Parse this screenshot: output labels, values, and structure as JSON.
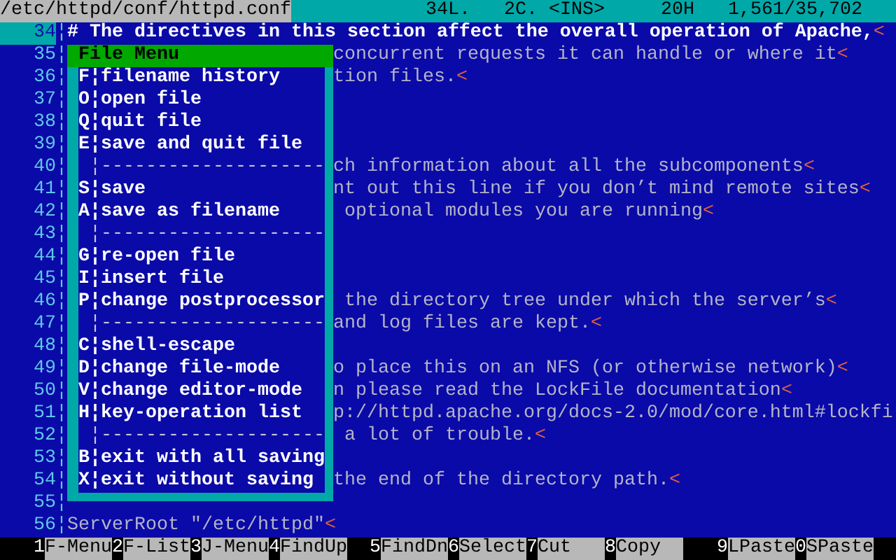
{
  "status_bar": {
    "path": "/etc/httpd/conf/httpd.conf",
    "fields": [
      "34L.",
      "2C.",
      "<INS>",
      "20H",
      "1,561/35,702"
    ]
  },
  "lines": [
    {
      "number": "34",
      "gutter": "¦",
      "text": "# The directives in this section affect the overall operation of Apache,",
      "eol": "<",
      "selected": true
    },
    {
      "number": "35",
      "gutter": "¦",
      "text": "concurrent requests it can handle or where it",
      "eol": "<",
      "selected": false
    },
    {
      "number": "36",
      "gutter": "¦",
      "text": "tion files.",
      "eol": "<",
      "selected": false
    },
    {
      "number": "37",
      "gutter": "¦",
      "selected": false
    },
    {
      "number": "38",
      "gutter": "¦",
      "selected": false
    },
    {
      "number": "39",
      "gutter": "¦",
      "selected": false
    },
    {
      "number": "40",
      "gutter": "¦",
      "text": "ch information about all the subcomponents",
      "eol": "<",
      "selected": false
    },
    {
      "number": "41",
      "gutter": "¦",
      "text": "nt out this line if you don’t mind remote sites",
      "eol": "<",
      "selected": false
    },
    {
      "number": "42",
      "gutter": "¦",
      "text": " optional modules you are running",
      "eol": "<",
      "selected": false
    },
    {
      "number": "43",
      "gutter": "¦",
      "selected": false
    },
    {
      "number": "44",
      "gutter": "¦",
      "selected": false
    },
    {
      "number": "45",
      "gutter": "¦",
      "selected": false
    },
    {
      "number": "46",
      "gutter": "¦",
      "text": " the directory tree under which the server’s",
      "eol": "<",
      "selected": false
    },
    {
      "number": "47",
      "gutter": "¦",
      "text": "and log files are kept.",
      "eol": "<",
      "selected": false
    },
    {
      "number": "48",
      "gutter": "¦",
      "selected": false
    },
    {
      "number": "49",
      "gutter": "¦",
      "text": "o place this on an NFS (or otherwise network)",
      "eol": "<",
      "selected": false
    },
    {
      "number": "50",
      "gutter": "¦",
      "text": "n please read the LockFile documentation",
      "eol": "<",
      "selected": false
    },
    {
      "number": "51",
      "gutter": "¦",
      "text": "p://httpd.apache.org/docs-2.0/mod/core.html#lockfi",
      "selected": false
    },
    {
      "number": "52",
      "gutter": "¦",
      "text": " a lot of trouble.",
      "eol": "<",
      "selected": false
    },
    {
      "number": "53",
      "gutter": "¦",
      "selected": false
    },
    {
      "number": "54",
      "gutter": "¦",
      "text": "the end of the directory path.",
      "eol": "<",
      "selected": false
    },
    {
      "number": "55",
      "gutter": "¦",
      "selected": false
    },
    {
      "number": "56",
      "gutter": "¦",
      "text": "ServerRoot \"/etc/httpd\"",
      "eol": "<",
      "selected": false
    }
  ],
  "file_menu": {
    "title": "File Menu",
    "items": [
      {
        "kind": "item",
        "text": "F¦filename history"
      },
      {
        "kind": "item",
        "text": "O¦open file"
      },
      {
        "kind": "item",
        "text": "Q¦quit file"
      },
      {
        "kind": "item",
        "text": "E¦save and quit file"
      },
      {
        "kind": "separator",
        "text": "¦--------------------"
      },
      {
        "kind": "item",
        "text": "S¦save"
      },
      {
        "kind": "item",
        "text": "A¦save as filename"
      },
      {
        "kind": "separator",
        "text": "¦--------------------"
      },
      {
        "kind": "item",
        "text": "G¦re-open file"
      },
      {
        "kind": "item",
        "text": "I¦insert file"
      },
      {
        "kind": "item",
        "text": "P¦change postprocessor"
      },
      {
        "kind": "separator",
        "text": "¦--------------------"
      },
      {
        "kind": "item",
        "text": "C¦shell-escape"
      },
      {
        "kind": "item",
        "text": "D¦change file-mode"
      },
      {
        "kind": "item",
        "text": "V¦change editor-mode"
      },
      {
        "kind": "item",
        "text": "H¦key-operation list"
      },
      {
        "kind": "separator",
        "text": "¦--------------------"
      },
      {
        "kind": "item",
        "text": "B¦exit with all saving"
      },
      {
        "kind": "item",
        "text": "X¦exit without saving"
      }
    ]
  },
  "function_keys": [
    {
      "key": "1",
      "label": "F-Menu"
    },
    {
      "key": "2",
      "label": "F-List"
    },
    {
      "key": "3",
      "label": "J-Menu"
    },
    {
      "key": "4",
      "label": "FindUp"
    },
    {
      "key": "5",
      "label": "FindDn"
    },
    {
      "key": "6",
      "label": "Select"
    },
    {
      "key": "7",
      "label": "Cut"
    },
    {
      "key": "8",
      "label": "Copy"
    },
    {
      "key": "9",
      "label": "LPaste"
    },
    {
      "key": "0",
      "label": "SPaste"
    }
  ]
}
